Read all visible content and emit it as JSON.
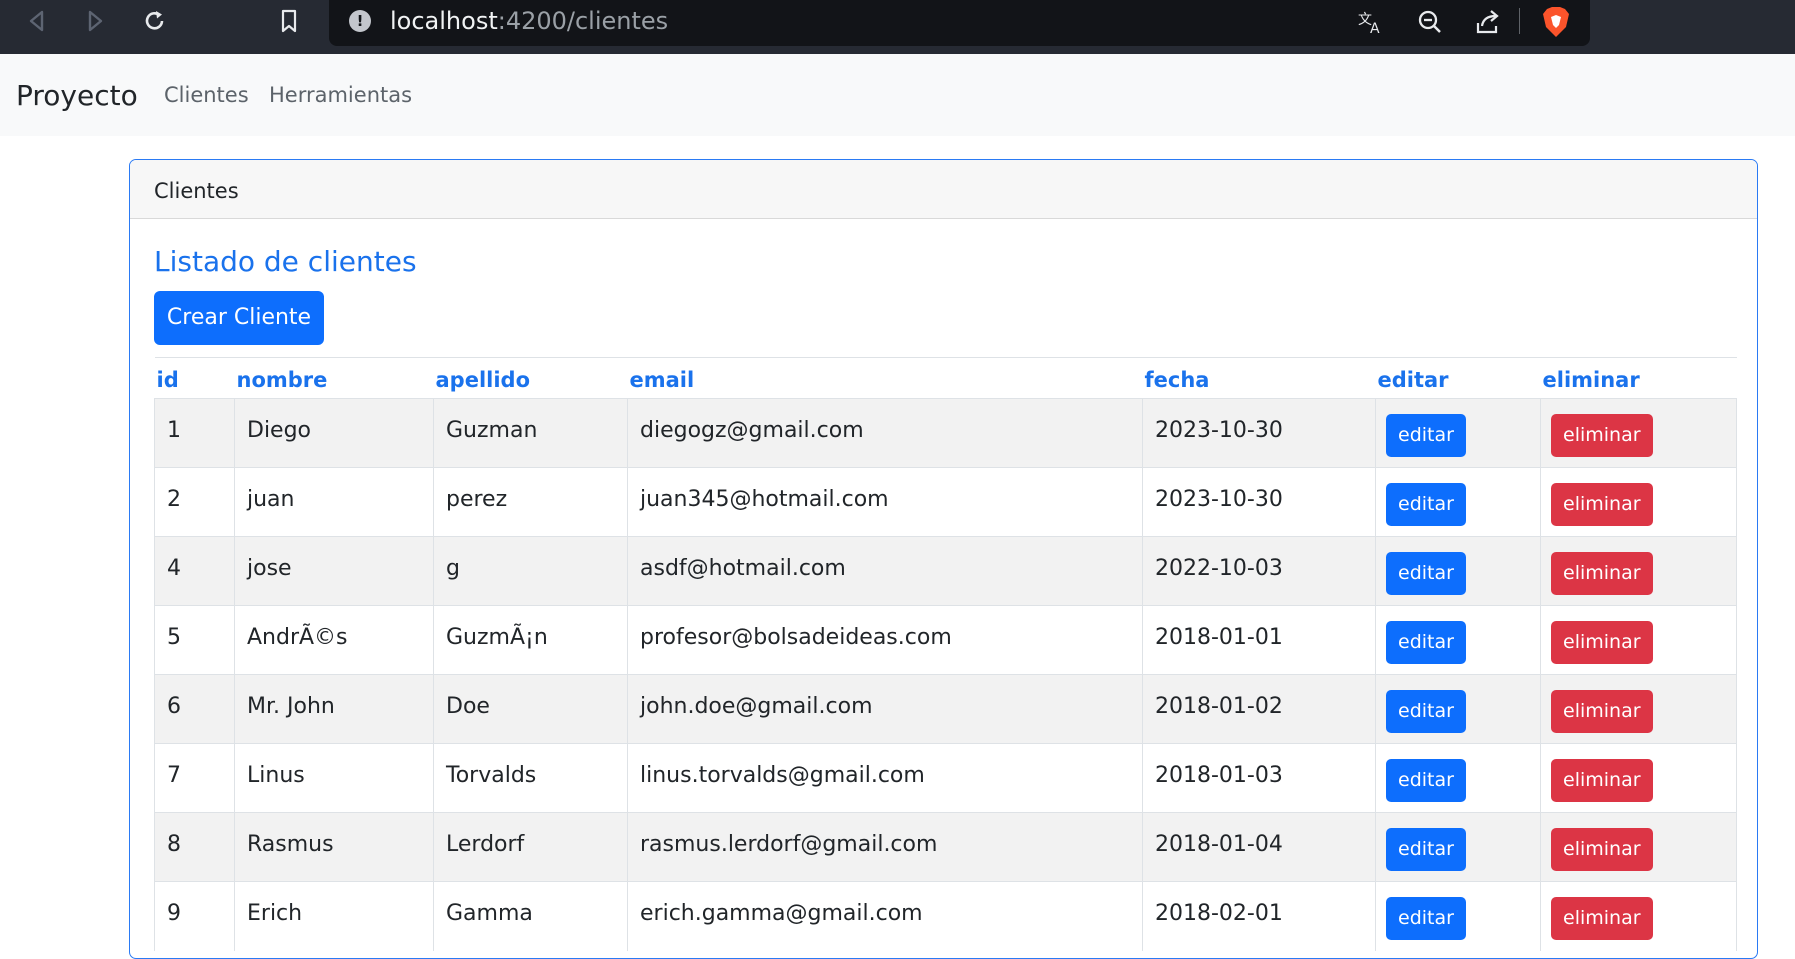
{
  "browser": {
    "url_host": "localhost",
    "url_path": ":4200/clientes"
  },
  "navbar": {
    "brand": "Proyecto",
    "links": [
      "Clientes",
      "Herramientas"
    ]
  },
  "card": {
    "header": "Clientes",
    "title": "Listado de clientes",
    "create_button": "Crear Cliente"
  },
  "table": {
    "columns": [
      "id",
      "nombre",
      "apellido",
      "email",
      "fecha",
      "editar",
      "eliminar"
    ],
    "edit_label": "editar",
    "delete_label": "eliminar",
    "rows": [
      {
        "id": "1",
        "nombre": "Diego",
        "apellido": "Guzman",
        "email": "diegogz@gmail.com",
        "fecha": "2023-10-30"
      },
      {
        "id": "2",
        "nombre": "juan",
        "apellido": "perez",
        "email": "juan345@hotmail.com",
        "fecha": "2023-10-30"
      },
      {
        "id": "4",
        "nombre": "jose",
        "apellido": "g",
        "email": "asdf@hotmail.com",
        "fecha": "2022-10-03"
      },
      {
        "id": "5",
        "nombre": "AndrÃ©s",
        "apellido": "GuzmÃ¡n",
        "email": "profesor@bolsadeideas.com",
        "fecha": "2018-01-01"
      },
      {
        "id": "6",
        "nombre": "Mr. John",
        "apellido": "Doe",
        "email": "john.doe@gmail.com",
        "fecha": "2018-01-02"
      },
      {
        "id": "7",
        "nombre": "Linus",
        "apellido": "Torvalds",
        "email": "linus.torvalds@gmail.com",
        "fecha": "2018-01-03"
      },
      {
        "id": "8",
        "nombre": "Rasmus",
        "apellido": "Lerdorf",
        "email": "rasmus.lerdorf@gmail.com",
        "fecha": "2018-01-04"
      },
      {
        "id": "9",
        "nombre": "Erich",
        "apellido": "Gamma",
        "email": "erich.gamma@gmail.com",
        "fecha": "2018-02-01"
      }
    ]
  },
  "colors": {
    "primary": "#0d6efd",
    "danger": "#dc3545",
    "heading_blue": "#1a72ec"
  }
}
